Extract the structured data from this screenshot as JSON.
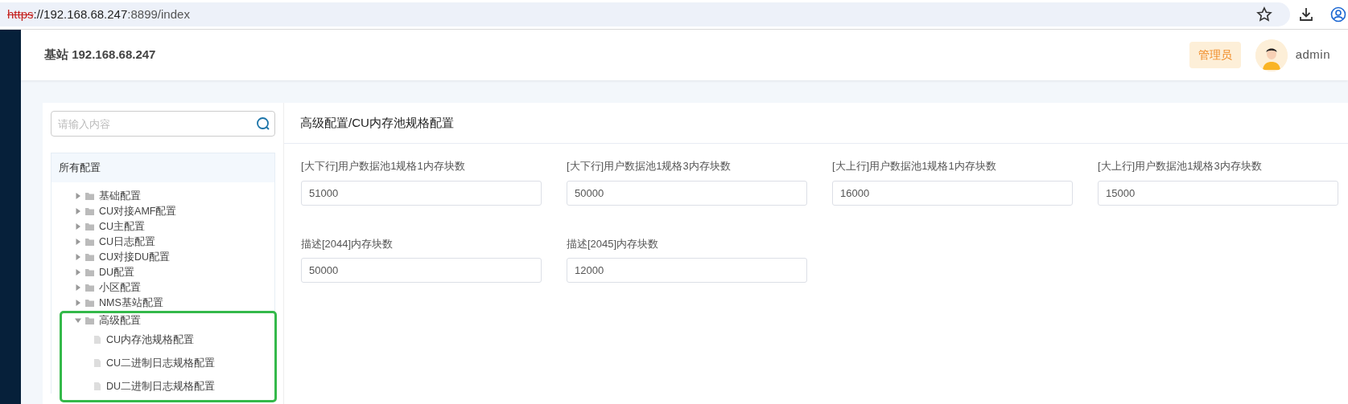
{
  "browser": {
    "url_scheme": "https",
    "url_host": "://192.168.68.247",
    "url_path": ":8899/index"
  },
  "header": {
    "title": "基站 192.168.68.247",
    "role_badge": "管理员",
    "username": "admin"
  },
  "search": {
    "placeholder": "请输入内容"
  },
  "tree": {
    "root": "所有配置",
    "nodes": [
      {
        "kind": "folder",
        "label": "基础配置",
        "expanded": false,
        "highlighted": false
      },
      {
        "kind": "folder",
        "label": "CU对接AMF配置",
        "expanded": false,
        "highlighted": false
      },
      {
        "kind": "folder",
        "label": "CU主配置",
        "expanded": false,
        "highlighted": false
      },
      {
        "kind": "folder",
        "label": "CU日志配置",
        "expanded": false,
        "highlighted": false
      },
      {
        "kind": "folder",
        "label": "CU对接DU配置",
        "expanded": false,
        "highlighted": false
      },
      {
        "kind": "folder",
        "label": "DU配置",
        "expanded": false,
        "highlighted": false
      },
      {
        "kind": "folder",
        "label": "小区配置",
        "expanded": false,
        "highlighted": false
      },
      {
        "kind": "folder",
        "label": "NMS基站配置",
        "expanded": false,
        "highlighted": false
      },
      {
        "kind": "folder",
        "label": "高级配置",
        "expanded": true,
        "highlighted": true,
        "children": [
          {
            "kind": "file",
            "label": "CU内存池规格配置"
          },
          {
            "kind": "file",
            "label": "CU二进制日志规格配置"
          },
          {
            "kind": "file",
            "label": "DU二进制日志规格配置"
          }
        ]
      }
    ]
  },
  "panel": {
    "title": "高级配置/CU内存池规格配置",
    "fields": [
      {
        "label": "[大下行]用户数据池1规格1内存块数",
        "value": "51000"
      },
      {
        "label": "[大下行]用户数据池1规格3内存块数",
        "value": "50000"
      },
      {
        "label": "[大上行]用户数据池1规格1内存块数",
        "value": "16000"
      },
      {
        "label": "[大上行]用户数据池1规格3内存块数",
        "value": "15000"
      },
      {
        "label": "描述[2044]内存块数",
        "value": "50000"
      },
      {
        "label": "描述[2045]内存块数",
        "value": "12000"
      }
    ]
  }
}
